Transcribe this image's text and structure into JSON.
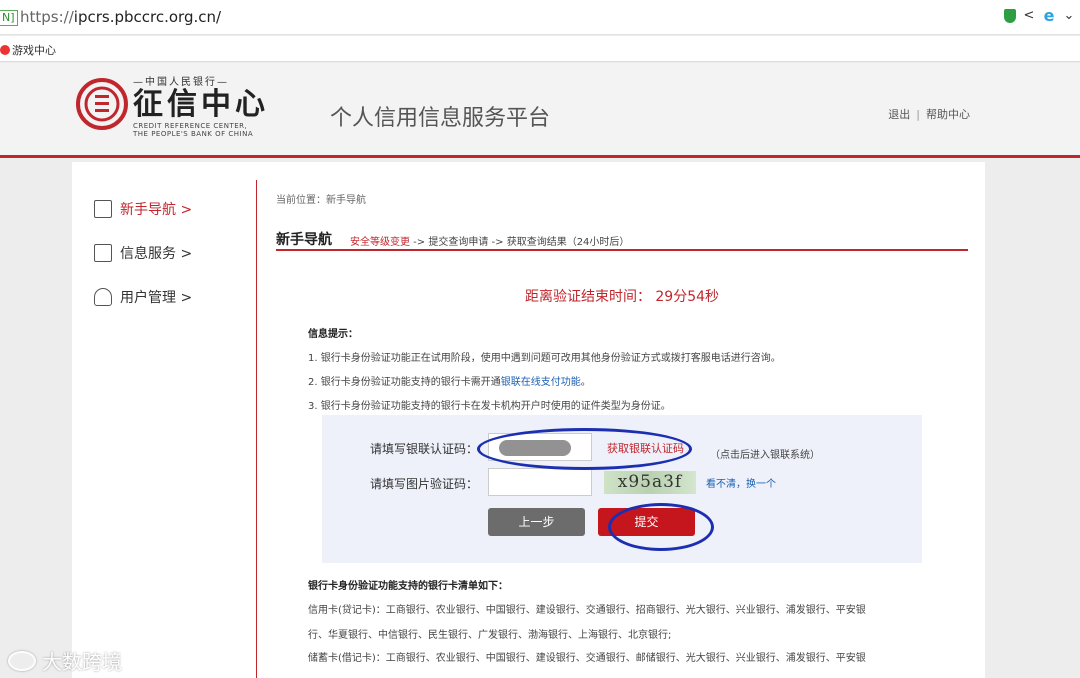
{
  "browser": {
    "secure_tag": "N]",
    "url_scheme": "https://",
    "url_host": "ipcrs.pbccrc.org.cn/",
    "bookmark": "游戏中心"
  },
  "header": {
    "logo_top": "—中国人民银行—",
    "logo_main": "征信中心",
    "logo_sub1": "CREDIT REFERENCE CENTER,",
    "logo_sub2": "THE PEOPLE'S BANK OF CHINA",
    "platform_title": "个人信用信息服务平台",
    "logout": "退出",
    "separator": "|",
    "help": "帮助中心"
  },
  "sidebar": {
    "items": [
      {
        "label": "新手导航 >",
        "icon": "book-icon"
      },
      {
        "label": "信息服务 >",
        "icon": "document-icon"
      },
      {
        "label": "用户管理 >",
        "icon": "user-icon"
      }
    ]
  },
  "content": {
    "breadcrumb": "当前位置：新手导航",
    "steps_title": "新手导航",
    "step1": "安全等级变更",
    "step_rest": " -> 提交查询申请 -> 获取查询结果（24小时后）",
    "timer": "距离验证结束时间：  29分54秒",
    "info_title": "信息提示：",
    "info1": "1. 银行卡身份验证功能正在试用阶段，使用中遇到问题可改用其他身份验证方式或拨打客服电话进行咨询。",
    "info2_a": "2. 银行卡身份验证功能支持的银行卡需开通",
    "info2_link": "银联在线支付功能",
    "info2_b": "。",
    "info3": "3. 银行卡身份验证功能支持的银行卡在发卡机构开户时使用的证件类型为身份证。"
  },
  "verify": {
    "unionpay_label": "请填写银联认证码：",
    "get_code": "获取银联认证码",
    "note": "（点击后进入银联系统）",
    "captcha_label": "请填写图片验证码：",
    "captcha_text": "x95a3f",
    "refresh": "看不清，换一个",
    "back_button": "上一步",
    "submit_button": "提交"
  },
  "banks": {
    "title": "银行卡身份验证功能支持的银行卡清单如下：",
    "credit1": "信用卡(贷记卡)：工商银行、农业银行、中国银行、建设银行、交通银行、招商银行、光大银行、兴业银行、浦发银行、平安银",
    "credit2": "行、华夏银行、中信银行、民生银行、广发银行、渤海银行、上海银行、北京银行;",
    "debit1": "储蓄卡(借记卡)：工商银行、农业银行、中国银行、建设银行、交通银行、邮储银行、光大银行、兴业银行、浦发银行、平安银"
  },
  "watermark": "大数跨境"
}
